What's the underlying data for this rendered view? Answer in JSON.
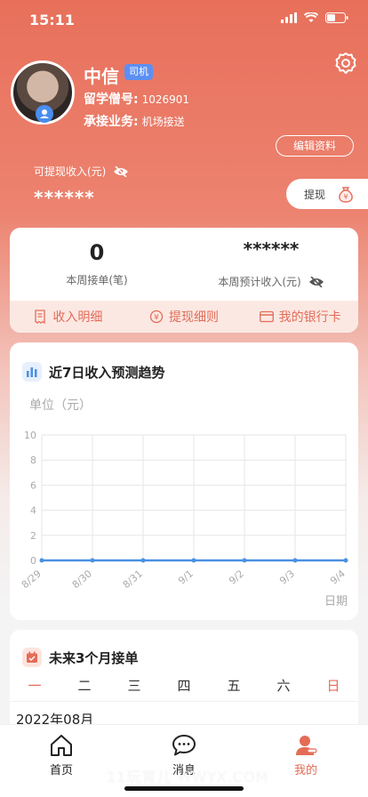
{
  "status_bar": {
    "time": "15:11"
  },
  "profile": {
    "name": "中信",
    "role_badge": "司机",
    "student_id_label": "留学僧号:",
    "student_id_value": "1026901",
    "business_label": "承接业务:",
    "business_value": "机场接送",
    "edit_label": "编辑资料"
  },
  "withdrawable": {
    "label": "可提现收入(元)",
    "value": "******",
    "withdraw_label": "提现"
  },
  "stats": {
    "orders_value": "0",
    "orders_label": "本周接单(笔)",
    "income_value": "******",
    "income_label": "本周预计收入(元)"
  },
  "actions": [
    {
      "label": "收入明细",
      "icon": "receipt-icon"
    },
    {
      "label": "提现细则",
      "icon": "withdraw-rule-icon"
    },
    {
      "label": "我的银行卡",
      "icon": "bank-card-icon"
    }
  ],
  "trend": {
    "title": "近7日收入预测趋势",
    "unit": "单位（元）"
  },
  "chart_data": {
    "type": "line",
    "categories": [
      "8/29",
      "8/30",
      "8/31",
      "9/1",
      "9/2",
      "9/3",
      "9/4"
    ],
    "values": [
      0,
      0,
      0,
      0,
      0,
      0,
      0
    ],
    "xlabel": "日期",
    "ylabel": "单位（元）",
    "ylim": [
      0,
      10
    ],
    "yticks": [
      "0",
      "2",
      "4",
      "6",
      "8",
      "10"
    ],
    "grid": true,
    "color": "#4a90e2"
  },
  "calendar": {
    "title": "未来3个月接单",
    "weekdays": [
      "一",
      "二",
      "三",
      "四",
      "五",
      "六",
      "日"
    ],
    "month": "2022年08月"
  },
  "tabbar": [
    {
      "label": "首页",
      "icon": "home-icon"
    },
    {
      "label": "消息",
      "icon": "message-icon"
    },
    {
      "label": "我的",
      "icon": "profile-icon"
    }
  ],
  "watermark": "11玩育儿 WWYX.COM",
  "colors": {
    "accent": "#e36c57",
    "header": "#e8705b",
    "badge": "#5b8ff2"
  }
}
